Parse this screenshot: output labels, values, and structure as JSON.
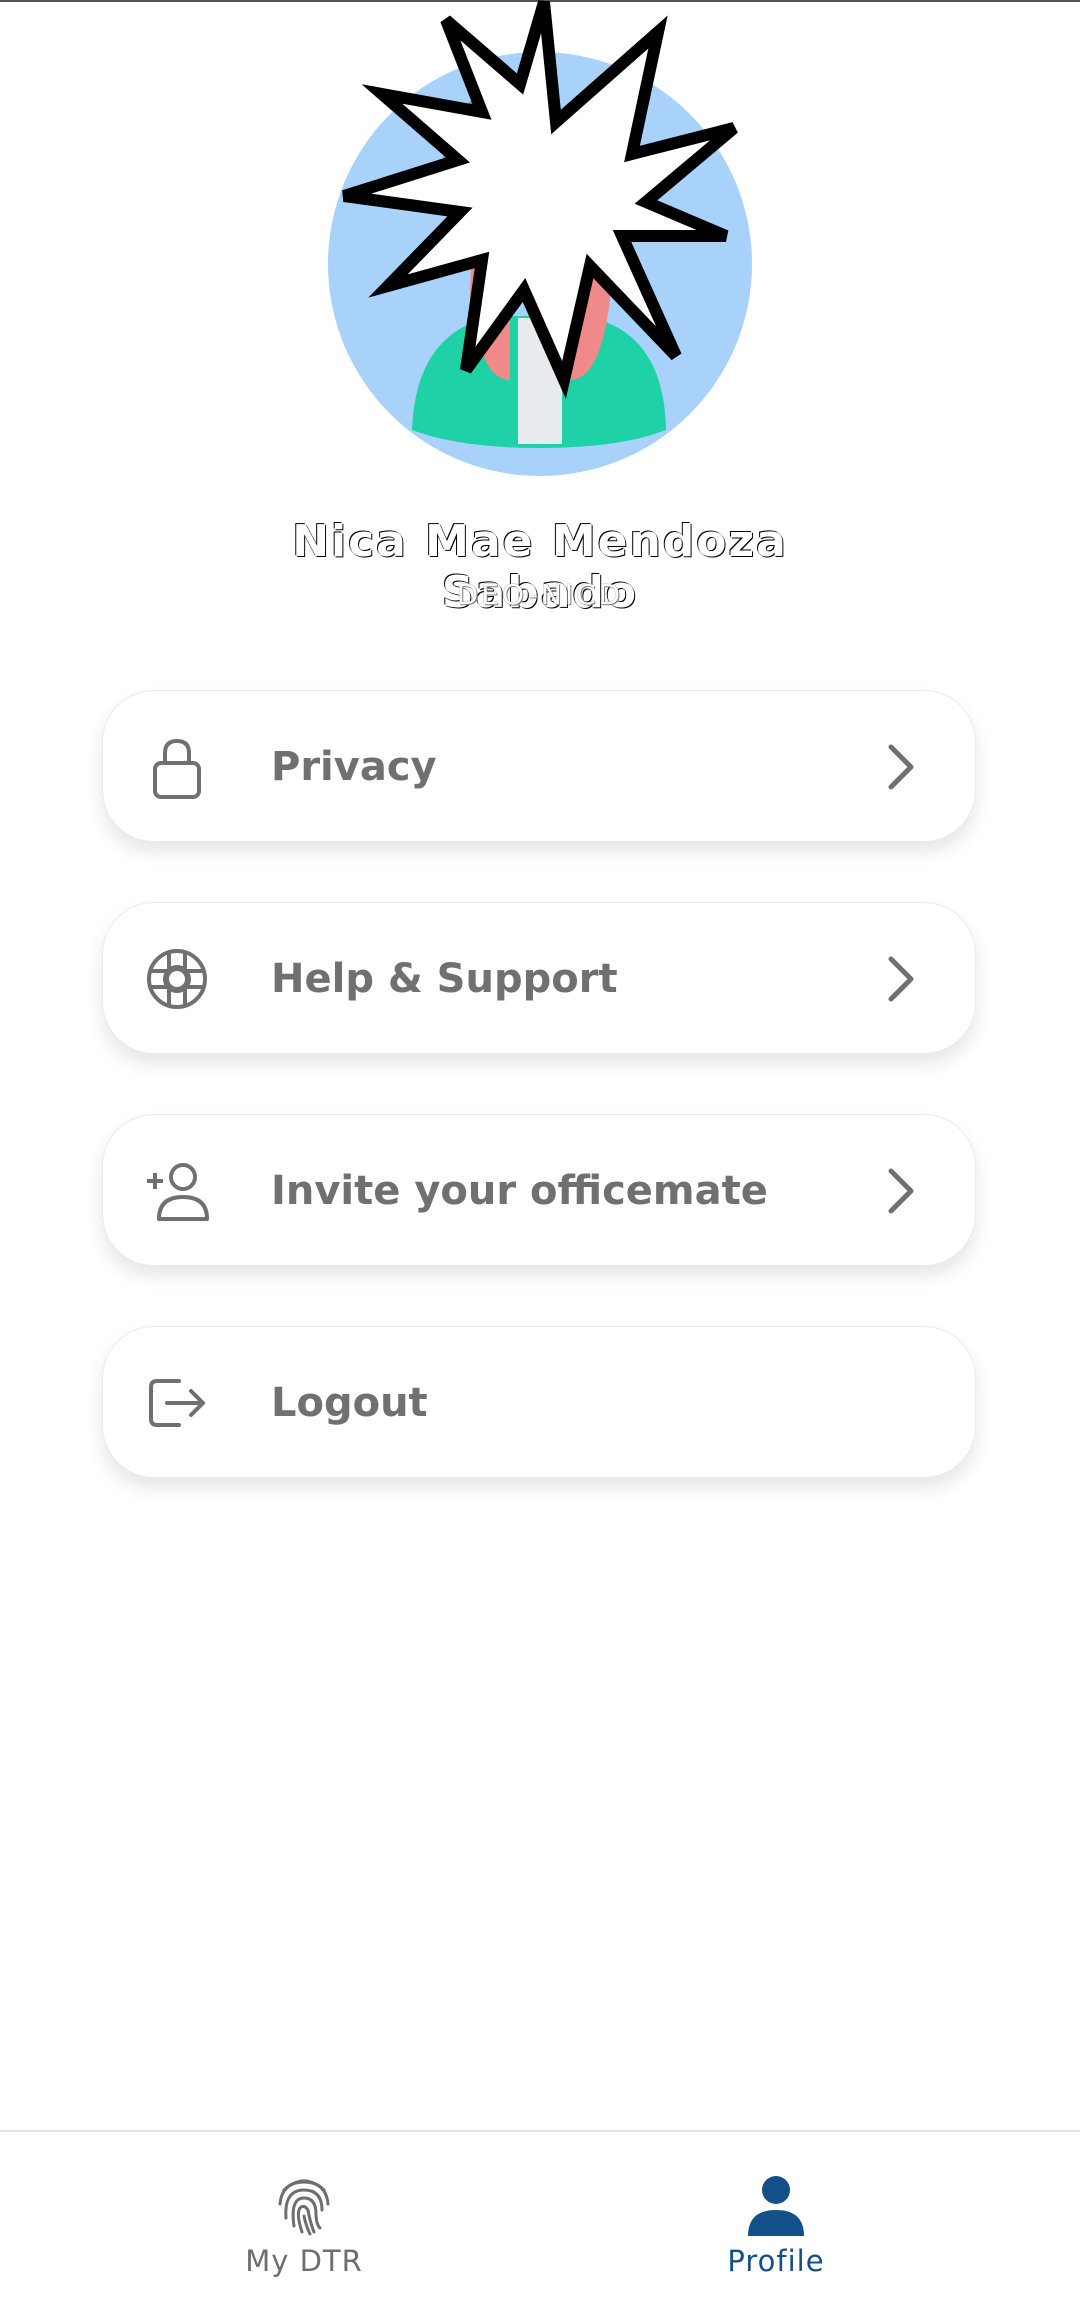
{
  "profile": {
    "name": "Nica Mae Mendoza Sabado",
    "id": "DEO-NICD",
    "avatar_icon": "avatar-illustration",
    "colors": {
      "avatar_bg": "#a9d2fb",
      "jacket": "#1fd1a6",
      "hair": "#f08a8a"
    }
  },
  "menu": {
    "items": [
      {
        "label": "Privacy",
        "icon": "lock-icon",
        "chevron": true
      },
      {
        "label": "Help & Support",
        "icon": "lifebuoy-icon",
        "chevron": true
      },
      {
        "label": "Invite your officemate",
        "icon": "add-user-icon",
        "chevron": true
      },
      {
        "label": "Logout",
        "icon": "logout-icon",
        "chevron": false
      }
    ]
  },
  "bottom_nav": {
    "tabs": [
      {
        "label": "My DTR",
        "icon": "fingerprint-icon",
        "active": false
      },
      {
        "label": "Profile",
        "icon": "person-icon",
        "active": true
      }
    ],
    "colors": {
      "active": "#13508a",
      "inactive": "#6e6e6e"
    }
  }
}
